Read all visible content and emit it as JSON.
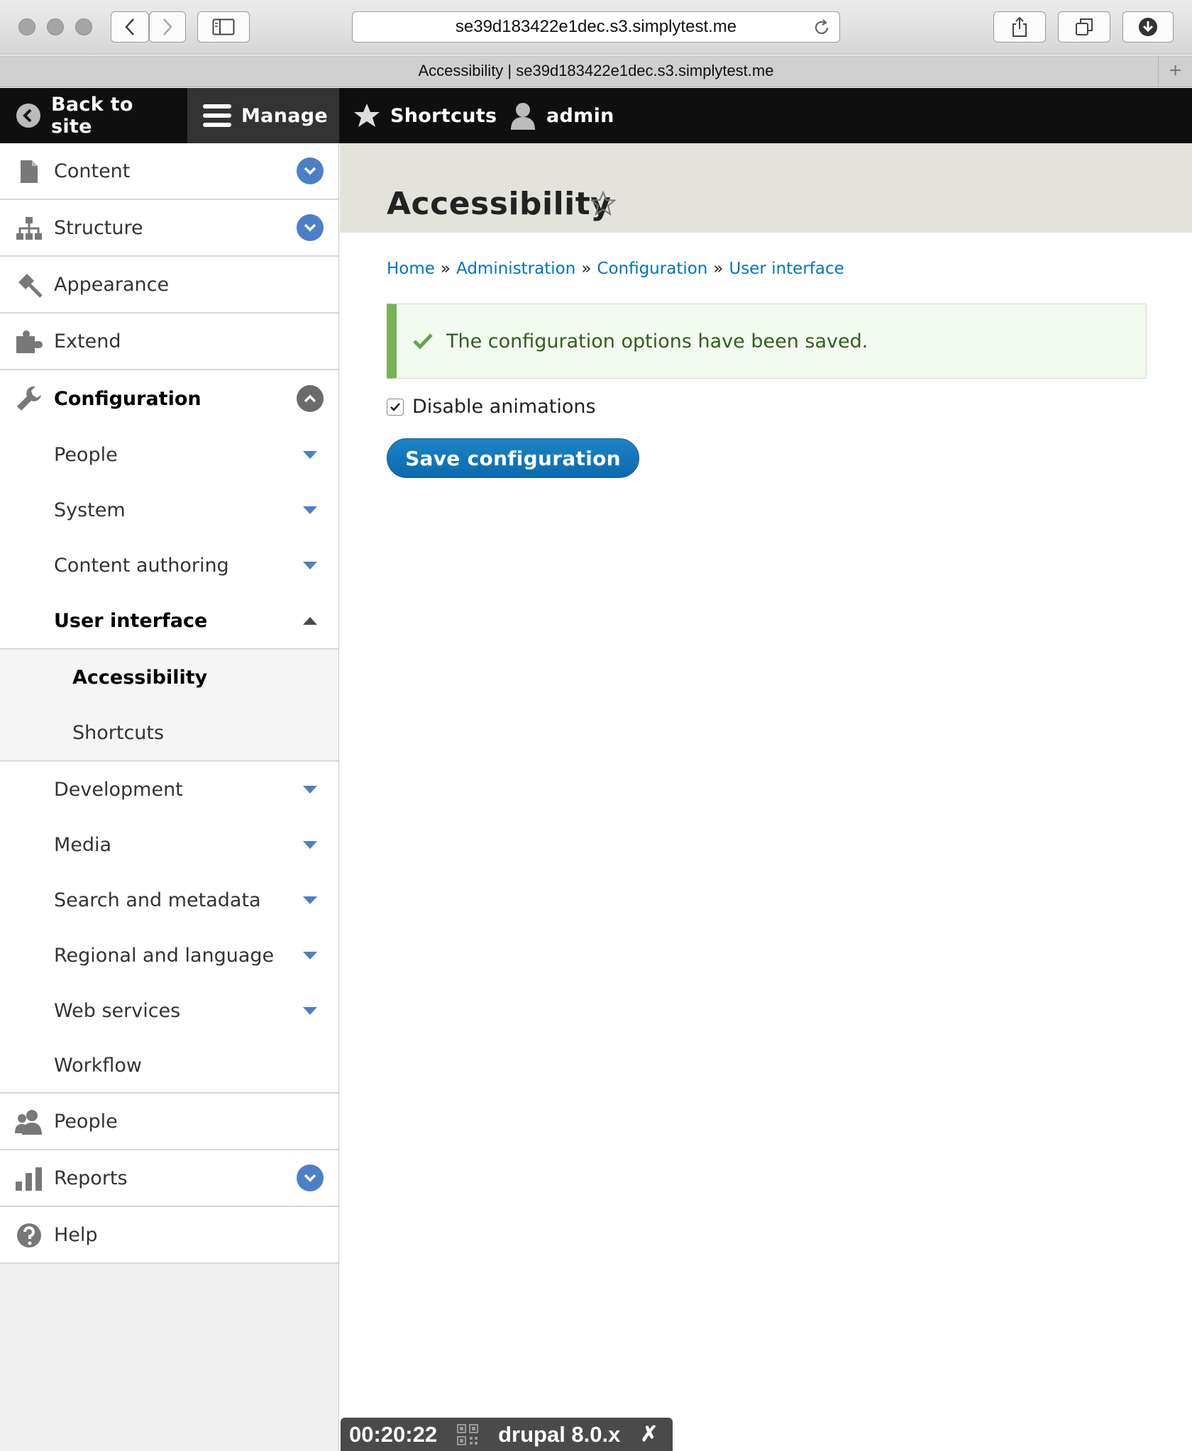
{
  "browser": {
    "url": "se39d183422e1dec.s3.simplytest.me",
    "tab_title": "Accessibility | se39d183422e1dec.s3.simplytest.me",
    "new_tab_label": "+"
  },
  "toolbar": {
    "back_to_site": "Back to site",
    "manage": "Manage",
    "shortcuts": "Shortcuts",
    "user": "admin"
  },
  "sidebar": {
    "content": "Content",
    "structure": "Structure",
    "appearance": "Appearance",
    "extend": "Extend",
    "configuration": "Configuration",
    "config_children": {
      "people": "People",
      "system": "System",
      "content_authoring": "Content authoring",
      "user_interface": "User interface",
      "accessibility": "Accessibility",
      "shortcuts": "Shortcuts",
      "development": "Development",
      "media": "Media",
      "search_metadata": "Search and metadata",
      "regional_language": "Regional and language",
      "web_services": "Web services",
      "workflow": "Workflow"
    },
    "people": "People",
    "reports": "Reports",
    "help": "Help"
  },
  "main": {
    "title": "Accessibility",
    "breadcrumb": [
      "Home",
      "Administration",
      "Configuration",
      "User interface"
    ],
    "breadcrumb_separator": "»",
    "status_message": "The configuration options have been saved.",
    "checkbox_label": "Disable animations",
    "checkbox_checked": true,
    "save_button": "Save configuration"
  },
  "overlay": {
    "timer": "00:20:22",
    "tag": "drupal 8.0.x",
    "close": "✗"
  },
  "colors": {
    "toolbar_bg": "#0f0f0f",
    "link_blue": "#0074bd",
    "toggle_blue": "#4d7fc9",
    "success_green": "#77b259",
    "button_blue": "#0a6ab0"
  }
}
